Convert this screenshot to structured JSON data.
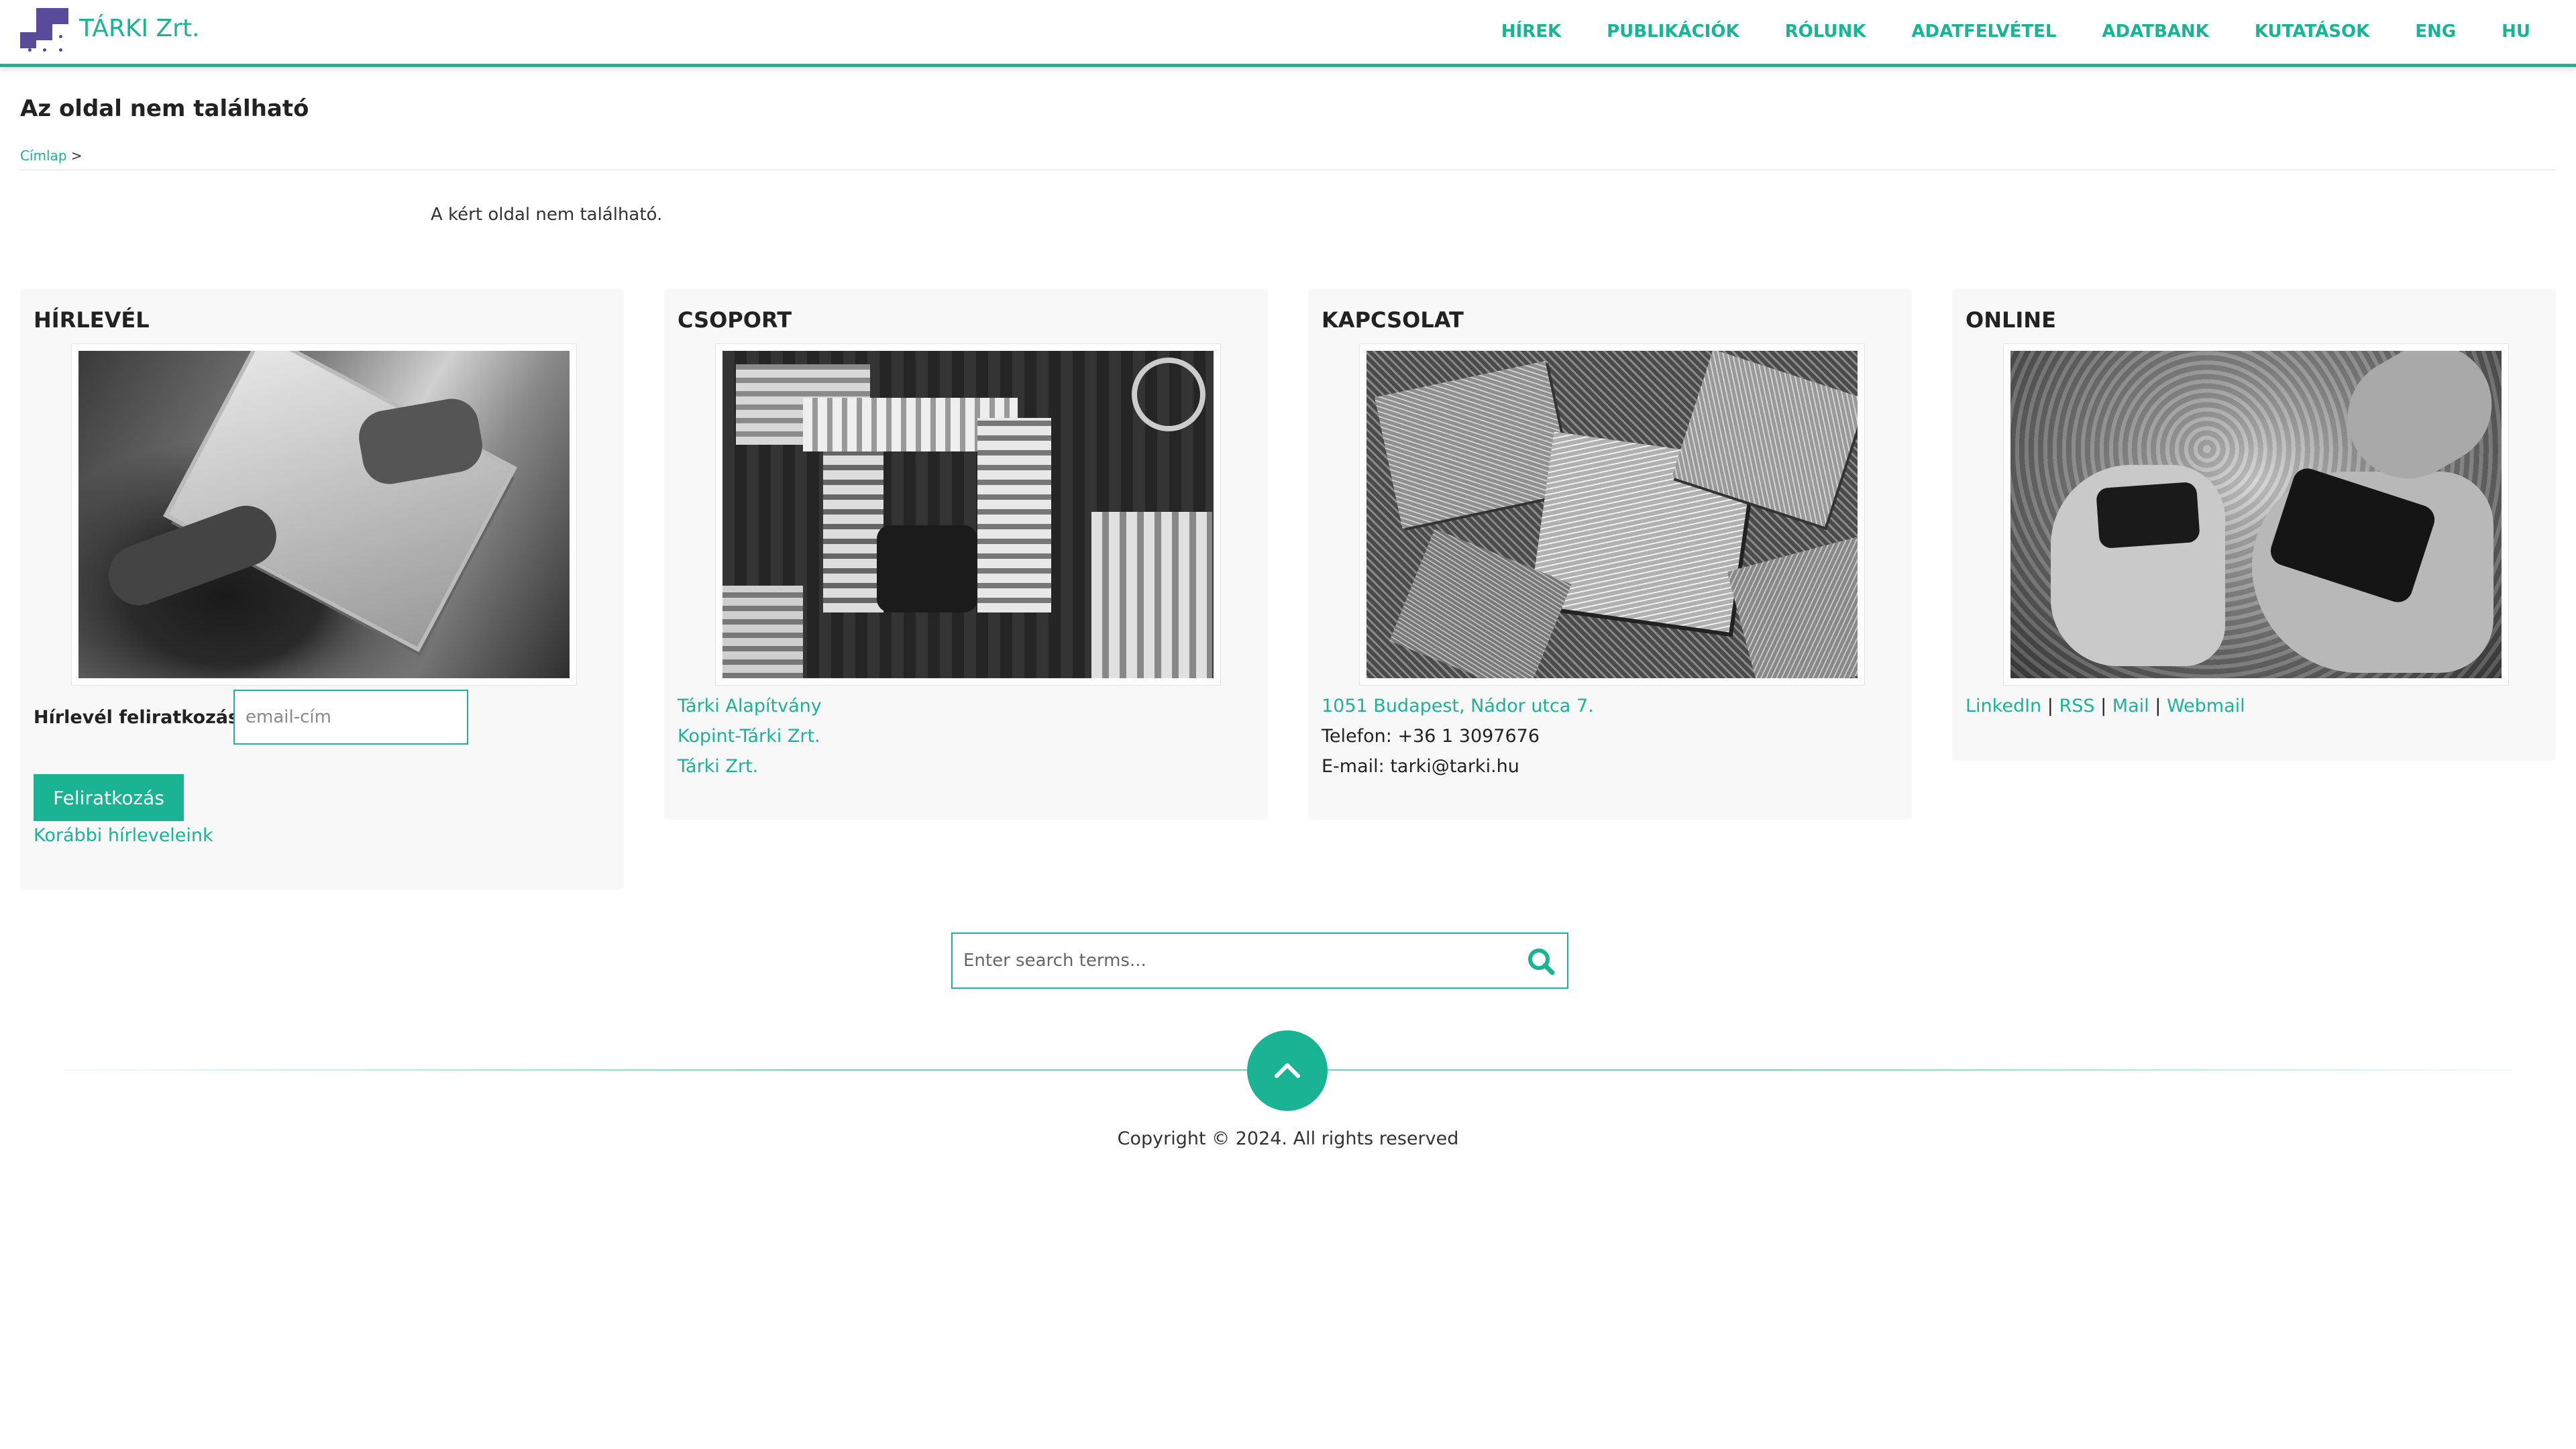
{
  "header": {
    "brand": "TÁRKI Zrt.",
    "nav": [
      "HÍREK",
      "PUBLIKÁCIÓK",
      "RÓLUNK",
      "ADATFELVÉTEL",
      "ADATBANK",
      "KUTATÁSOK",
      "ENG",
      "HU"
    ]
  },
  "page": {
    "title": "Az oldal nem található",
    "breadcrumb": {
      "home": "Címlap",
      "separator": ">"
    },
    "message": "A kért oldal nem található."
  },
  "panels": {
    "newsletter": {
      "title": "HÍRLEVÉL",
      "label": "Hírlevél feliratkozás",
      "placeholder": "email-cím",
      "button": "Feliratkozás",
      "previous_link": "Korábbi hírleveleink"
    },
    "group": {
      "title": "CSOPORT",
      "links": [
        "Tárki Alapítvány",
        "Kopint-Tárki Zrt.",
        "Tárki Zrt."
      ]
    },
    "contact": {
      "title": "KAPCSOLAT",
      "address": "1051 Budapest, Nádor utca 7.",
      "phone": "Telefon: +36 1 3097676",
      "email": "E-mail: tarki@tarki.hu"
    },
    "online": {
      "title": "ONLINE",
      "links": [
        "LinkedIn",
        "RSS",
        "Mail",
        "Webmail"
      ],
      "separator": "|"
    }
  },
  "search": {
    "placeholder": "Enter search terms..."
  },
  "footer": {
    "copyright": "Copyright © 2024. All rights reserved"
  },
  "colors": {
    "accent": "#1ab394",
    "logo": "#5a4a9a",
    "panel_bg": "#f8f8f8"
  },
  "icons": [
    "tarki-logo-icon",
    "search-icon",
    "chevron-up-icon"
  ]
}
